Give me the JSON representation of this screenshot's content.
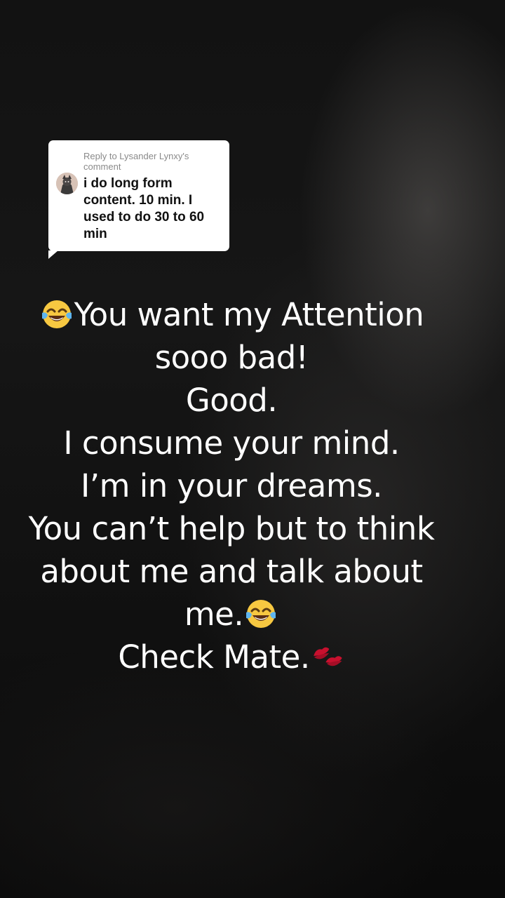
{
  "reply": {
    "header": "Reply to Lysander Lynxy's comment",
    "comment": "i do long form content. 10 min. I used to do 30 to 60 min"
  },
  "caption": {
    "line1": "You want my Attention",
    "line2": "sooo bad!",
    "line3": "Good.",
    "line4": "I’m in your dreams.",
    "line4a": "I consume your mind.",
    "line5": "You can’t help but to think",
    "line6": "about me and talk about",
    "line7": "me.",
    "line8": "Check Mate."
  },
  "icons": {
    "laugh_emoji": "face-with-tears-of-joy-icon",
    "kiss_emoji": "kiss-mark-icon"
  },
  "colors": {
    "caption_text": "#ffffff",
    "card_bg": "#ffffff",
    "card_header": "#8a8a8a",
    "card_text": "#111111"
  }
}
